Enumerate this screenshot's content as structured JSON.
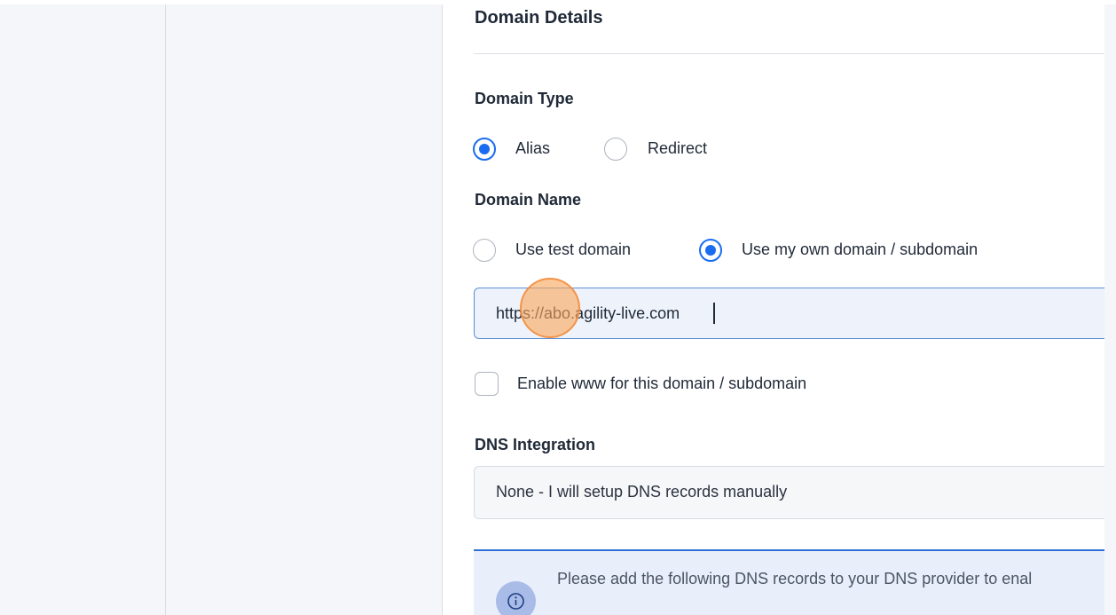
{
  "domain_details": {
    "title": "Domain Details"
  },
  "domain_type": {
    "label": "Domain Type",
    "options": [
      {
        "label": "Alias",
        "selected": true
      },
      {
        "label": "Redirect",
        "selected": false
      }
    ]
  },
  "domain_name": {
    "label": "Domain Name",
    "options": [
      {
        "label": "Use test domain",
        "selected": false
      },
      {
        "label": "Use my own domain / subdomain",
        "selected": true
      }
    ],
    "input_value": "https://abo.agility-live.com"
  },
  "enable_www": {
    "label": "Enable www for this domain / subdomain",
    "checked": false
  },
  "dns_integration": {
    "label": "DNS Integration",
    "selected_value": "None - I will setup DNS records manually"
  },
  "info_notice": {
    "text": "Please add the following DNS records to your DNS provider to enal",
    "icon": "info-icon"
  },
  "colors": {
    "accent": "#1a6cf0",
    "info_border": "#2f6fd6",
    "info_bg": "#e9effa",
    "cursor_highlight": "#f9a65c"
  }
}
